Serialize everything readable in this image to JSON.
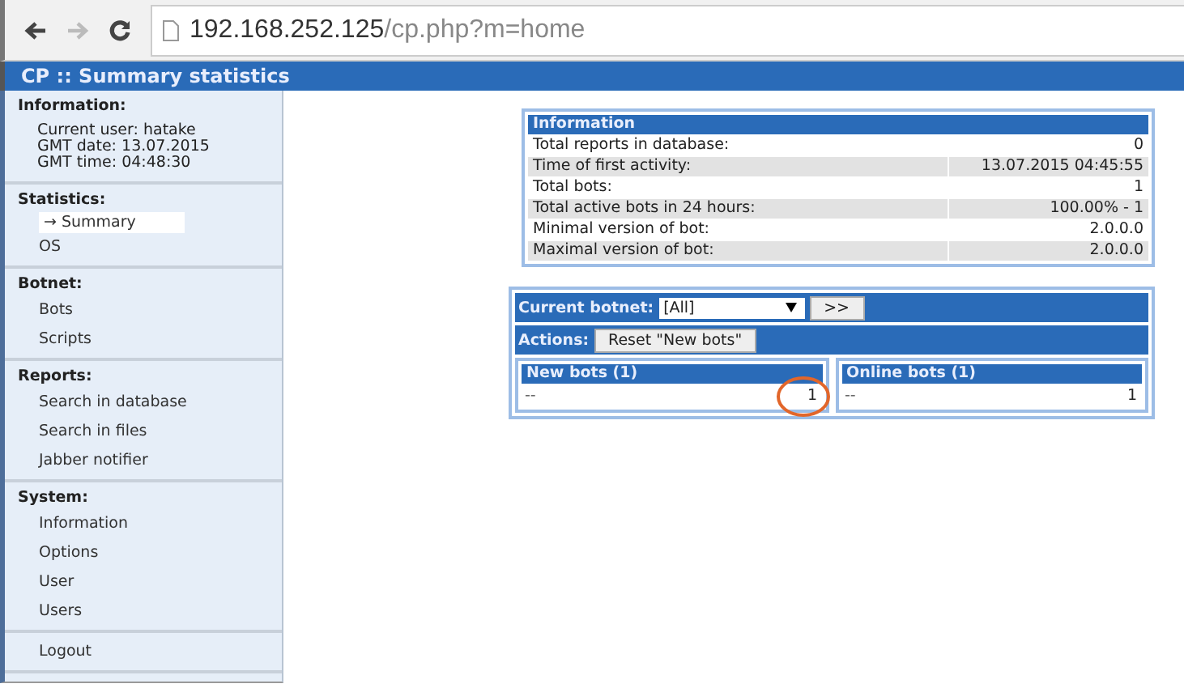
{
  "browser": {
    "url_host": "192.168.252.125",
    "url_path": "/cp.php?m=home"
  },
  "title": "CP :: Summary statistics",
  "sidebar": {
    "current_marker": "→",
    "sections": [
      {
        "heading": "Information:",
        "kind": "info",
        "lines": [
          "Current user: hatake",
          "GMT date: 13.07.2015",
          "GMT time: 04:48:30"
        ]
      },
      {
        "heading": "Statistics:",
        "kind": "links",
        "items": [
          {
            "label": "Summary",
            "selected": true
          },
          {
            "label": "OS",
            "selected": false
          }
        ]
      },
      {
        "heading": "Botnet:",
        "kind": "links",
        "items": [
          {
            "label": "Bots",
            "selected": false
          },
          {
            "label": "Scripts",
            "selected": false
          }
        ]
      },
      {
        "heading": "Reports:",
        "kind": "links",
        "items": [
          {
            "label": "Search in database",
            "selected": false
          },
          {
            "label": "Search in files",
            "selected": false
          },
          {
            "label": "Jabber notifier",
            "selected": false
          }
        ]
      },
      {
        "heading": "System:",
        "kind": "links",
        "items": [
          {
            "label": "Information",
            "selected": false
          },
          {
            "label": "Options",
            "selected": false
          },
          {
            "label": "User",
            "selected": false
          },
          {
            "label": "Users",
            "selected": false
          }
        ]
      },
      {
        "kind": "links",
        "items": [
          {
            "label": "Logout",
            "selected": false
          }
        ]
      }
    ]
  },
  "info_table": {
    "title": "Information",
    "rows": [
      {
        "label": "Total reports in database:",
        "value": "0"
      },
      {
        "label": "Time of first activity:",
        "value": "13.07.2015 04:45:55"
      },
      {
        "label": "Total bots:",
        "value": "1"
      },
      {
        "label": "Total active bots in 24 hours:",
        "value": "100.00% - 1"
      },
      {
        "label": "Minimal version of bot:",
        "value": "2.0.0.0"
      },
      {
        "label": "Maximal version of bot:",
        "value": "2.0.0.0"
      }
    ]
  },
  "botnet_panel": {
    "botnet_label": "Current botnet:",
    "botnet_select": "[All]",
    "go_button": ">>",
    "actions_label": "Actions:",
    "reset_button": "Reset \"New bots\"",
    "lists": [
      {
        "title": "New bots (1)",
        "highlighted": true,
        "rows": [
          {
            "column_1": "--",
            "column_2": "1"
          }
        ]
      },
      {
        "title": "Online bots (1)",
        "highlighted": false,
        "rows": [
          {
            "column_1": "--",
            "column_2": "1"
          }
        ]
      }
    ]
  }
}
